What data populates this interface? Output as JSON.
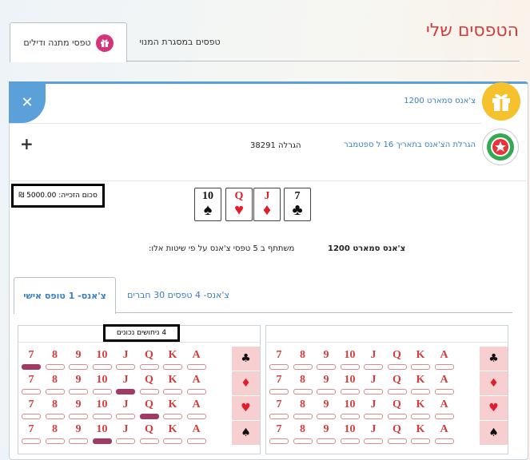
{
  "page": {
    "title": "הטפסים שלי"
  },
  "tabs": [
    {
      "label": "טפסי מתנה ודילים",
      "active": true,
      "icon": "gift-icon"
    },
    {
      "label": "טפסים במסגרת המנוי",
      "active": false
    }
  ],
  "form": {
    "name": "צ'אנס סמארט 1200",
    "draw_link": "הגרלת הצ'אנס בתאריך 16 ל ספטמבר",
    "draw_number": "הגרלה 38291",
    "prize": "סכום הזכייה: 5000.00 ₪",
    "cards": [
      {
        "rank": "10",
        "suit": "♠",
        "color": "black"
      },
      {
        "rank": "Q",
        "suit": "♥",
        "color": "red"
      },
      {
        "rank": "J",
        "suit": "♦",
        "color": "red"
      },
      {
        "rank": "7",
        "suit": "♣",
        "color": "black"
      }
    ],
    "participation_title": "צ'אנס סמארט 1200",
    "participation_text": "משתתף ב 5 טפסי צ'אנס על פי שיטות אלו:"
  },
  "inner_tabs": [
    {
      "label": "צ'אנס- 1 טופס אישי",
      "active": true
    },
    {
      "label": "צ'אנס- 4 טפסים 30 חברים",
      "active": false
    }
  ],
  "boards": [
    {
      "correct_label": "4 ניחושים נכונים",
      "ranks": [
        "7",
        "8",
        "9",
        "10",
        "J",
        "Q",
        "K",
        "A"
      ],
      "suits": [
        "♣",
        "♦",
        "♥",
        "♠"
      ],
      "selected": {
        "0": "7",
        "1": "J",
        "2": "Q",
        "3": "10"
      }
    },
    {
      "correct_label": "",
      "ranks": [
        "7",
        "8",
        "9",
        "10",
        "J",
        "Q",
        "K",
        "A"
      ],
      "suits": [
        "♣",
        "♦",
        "♥",
        "♠"
      ],
      "selected": {}
    }
  ],
  "colors": {
    "accent": "#5ba0d8",
    "title_red": "#d43d3d",
    "gift_yellow": "#f5c12d",
    "selected": "#a13b65"
  }
}
